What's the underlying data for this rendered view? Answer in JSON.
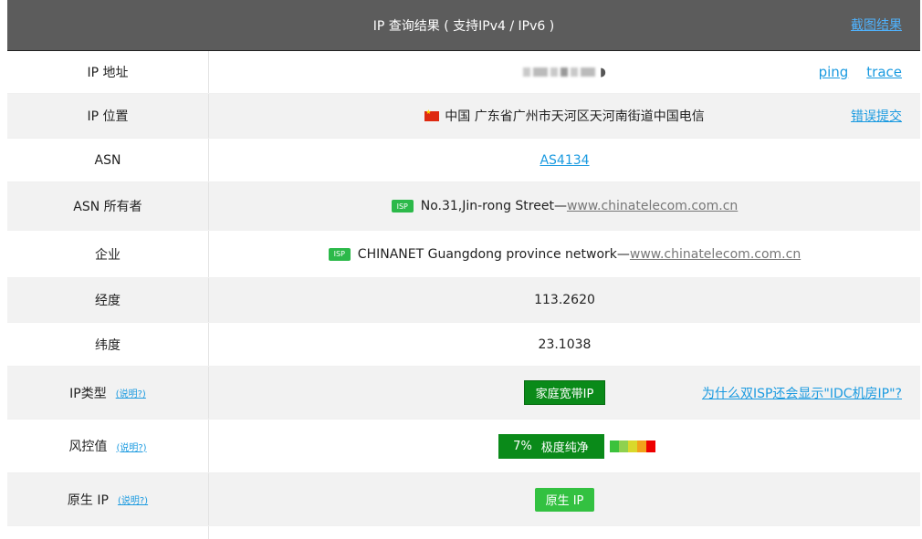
{
  "header": {
    "title": "IP 查询结果 ( 支持IPv4 / IPv6 )",
    "screenshot_link": "截图结果"
  },
  "rows": {
    "ip": {
      "label": "IP 地址",
      "actions": [
        "ping",
        "trace"
      ]
    },
    "location": {
      "label": "IP 位置",
      "value": "中国 广东省广州市天河区天河南街道中国电信",
      "action": "错误提交"
    },
    "asn": {
      "label": "ASN",
      "value": "AS4134"
    },
    "asn_owner": {
      "label": "ASN 所有者",
      "badge": "ISP",
      "value": "No.31,Jin-rong Street— ",
      "link": "www.chinatelecom.com.cn"
    },
    "org": {
      "label": "企业",
      "badge": "ISP",
      "value": "CHINANET Guangdong province network— ",
      "link": "www.chinatelecom.com.cn"
    },
    "longitude": {
      "label": "经度",
      "value": "113.2620"
    },
    "latitude": {
      "label": "纬度",
      "value": "23.1038"
    },
    "ip_type": {
      "label": "IP类型",
      "help": "(说明?)",
      "tag": "家庭宽带IP",
      "action": "为什么双ISP还会显示\"IDC机房IP\"?"
    },
    "risk": {
      "label": "风控值",
      "help": "(说明?)",
      "percent": "7%",
      "level": "极度纯净",
      "scale_colors": [
        "#3cc23c",
        "#8fd14f",
        "#d9d92b",
        "#f2a21a",
        "#ee0000"
      ]
    },
    "native": {
      "label": "原生 IP",
      "help": "(说明?)",
      "tag": "原生 IP"
    }
  }
}
